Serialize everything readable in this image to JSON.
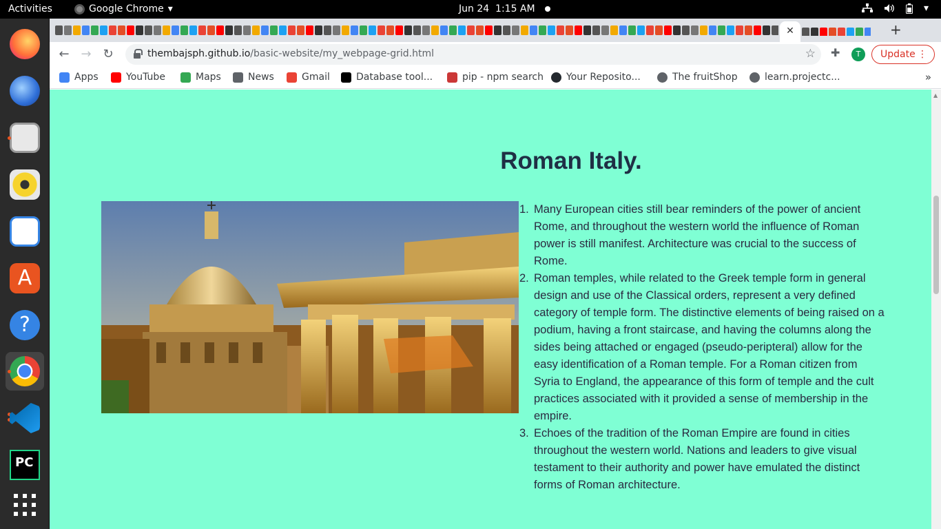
{
  "topbar": {
    "activities": "Activities",
    "app_name": "Google Chrome",
    "date": "Jun 24",
    "time": "1:15 AM"
  },
  "dock": {
    "items": [
      {
        "name": "firefox",
        "color": "#ff7139"
      },
      {
        "name": "thunderbird",
        "color": "#2f6fd8"
      },
      {
        "name": "files",
        "color": "#e8e8e8"
      },
      {
        "name": "rhythmbox",
        "color": "#f6d32d"
      },
      {
        "name": "libreoffice-writer",
        "color": "#3584e4"
      },
      {
        "name": "ubuntu-software",
        "color": "#e95420"
      },
      {
        "name": "help",
        "color": "#3584e4"
      },
      {
        "name": "chrome",
        "color": "#4285f4"
      },
      {
        "name": "vscode",
        "color": "#0078d4"
      },
      {
        "name": "pycharm",
        "color": "#21d789"
      },
      {
        "name": "show-applications",
        "color": "#ffffff"
      }
    ]
  },
  "browser": {
    "active_tab_close": "✕",
    "new_tab": "+",
    "url_host": "thembajsph.github.io",
    "url_path": "/basic-website/my_webpage-grid.html",
    "avatar_letter": "T",
    "update_label": "Update",
    "bookmarks": [
      {
        "label": "Apps",
        "icon": "apps-grid-icon",
        "color": "#4285f4"
      },
      {
        "label": "YouTube",
        "icon": "youtube-icon",
        "color": "#ff0000"
      },
      {
        "label": "Maps",
        "icon": "maps-icon",
        "color": "#34a853"
      },
      {
        "label": "News",
        "icon": "news-icon",
        "color": "#5f6368"
      },
      {
        "label": "Gmail",
        "icon": "gmail-icon",
        "color": "#ea4335"
      },
      {
        "label": "Database tool...",
        "icon": "jetbrains-icon",
        "color": "#000000"
      },
      {
        "label": "pip - npm search",
        "icon": "npm-icon",
        "color": "#cb3837"
      },
      {
        "label": "Your Reposito...",
        "icon": "github-icon",
        "color": "#24292e"
      },
      {
        "label": "The fruitShop",
        "icon": "globe-icon",
        "color": "#5f6368"
      },
      {
        "label": "learn.projectc...",
        "icon": "globe-icon",
        "color": "#5f6368"
      }
    ]
  },
  "page": {
    "heading": "Roman Italy.",
    "facts": [
      "Many European cities still bear reminders of the power of ancient Rome, and throughout the western world the influence of Roman power is still manifest. Architecture was crucial to the success of Rome.",
      "Roman temples, while related to the Greek temple form in general design and use of the Classical orders, represent a very defined category of temple form. The distinctive elements of being raised on a podium, having a front staircase, and having the columns along the sides being attached or engaged (pseudo-peripteral) allow for the easy identification of a Roman temple. For a Roman citizen from Syria to England, the appearance of this form of temple and the cult practices associated with it provided a sense of membership in the empire.",
      "Echoes of the tradition of the Roman Empire are found in cities throughout the western world. Nations and leaders to give visual testament to their authority and power have emulated the distinct forms of Roman architecture."
    ],
    "colors": {
      "background": "#7fffd4",
      "heading": "#1f2f45"
    }
  }
}
